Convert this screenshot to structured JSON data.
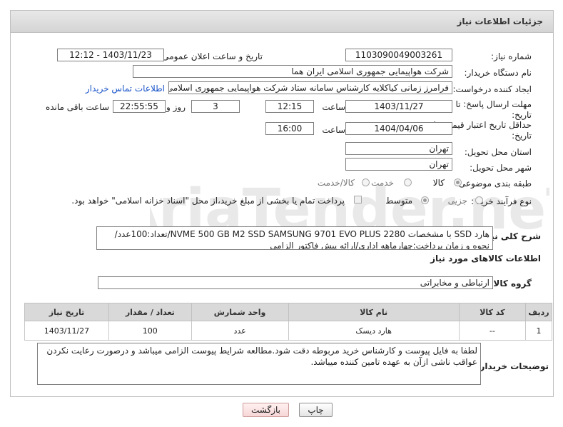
{
  "header": {
    "title": "جزئیات اطلاعات نیاز"
  },
  "fields": {
    "need_number_label": "شماره نیاز:",
    "need_number": "1103090049003261",
    "announce_label": "تاریخ و ساعت اعلان عمومی:",
    "announce_value": "1403/11/23 - 12:12",
    "buyer_org_label": "نام دستگاه خریدار:",
    "buyer_org": "شرکت هواپیمایی جمهوری اسلامی ایران هما",
    "requester_label": "ایجاد کننده درخواست:",
    "requester": "فرامرز زمانی کیاکلایه کارشناس سامانه ستاد شرکت هواپیمایی جمهوری اسلامی",
    "contact_link": "اطلاعات تماس خریدار",
    "reply_deadline_label_1": "مهلت ارسال پاسخ: تا",
    "reply_deadline_label_2": "تاریخ:",
    "reply_date": "1403/11/27",
    "time_label": "ساعت",
    "reply_time": "12:15",
    "days_value": "3",
    "days_label": "روز و",
    "remaining_time": "22:55:55",
    "remaining_label": "ساعت باقی مانده",
    "price_validity_label_1": "حداقل تاریخ اعتبار قیمت: تا",
    "price_validity_label_2": "تاریخ:",
    "price_date": "1404/04/06",
    "price_time": "16:00",
    "province_label": "استان محل تحویل:",
    "province": "تهران",
    "city_label": "شهر محل تحویل:",
    "city": "تهران",
    "category_label": "طبقه بندی موضوعی:",
    "category_options": [
      "کالا",
      "خدمت",
      "کالا/خدمت"
    ],
    "process_label": "نوع فرآیند خرید :",
    "process_options": [
      "جزیی",
      "متوسط"
    ],
    "payment_note": "پرداخت تمام یا بخشی از مبلغ خرید،از محل \"اسناد خزانه اسلامی\" خواهد بود."
  },
  "description": {
    "label": "شرح کلی نیاز:",
    "text": "هارد SSD با مشخصات NVME 500 GB M2 SSD  SAMSUNG 9701 EVO PLUS 2280/تعداد:100عدد/نحوه و زمان پرداخت:چهارماهه اداری/ارائه پیش فاکتور الزامی"
  },
  "goods_info": {
    "title": "اطلاعات کالاهای مورد نیاز",
    "group_label": "گروه کالا:",
    "group_value": "ارتباطی و مخابراتی"
  },
  "table": {
    "headers": [
      "ردیف",
      "کد کالا",
      "نام کالا",
      "واحد شمارش",
      "تعداد / مقدار",
      "تاریخ نیاز"
    ],
    "rows": [
      [
        "1",
        "--",
        "هارد دیسک",
        "عدد",
        "100",
        "1403/11/27"
      ]
    ]
  },
  "buyer_notes": {
    "label": "توضیحات خریدار:",
    "text": "لطفا به فایل پیوست و کارشناس خرید مربوطه دقت شود.مطالعه شرایط پیوست الزامی میباشد و درصورت رعایت نکردن عواقب ناشی ازآن به عهده تامین کننده میباشد."
  },
  "buttons": {
    "print": "چاپ",
    "back": "بازگشت"
  },
  "watermark": {
    "text": "AriaTender.neT"
  },
  "colors": {
    "link": "#1a55c8",
    "header_bg": "#d9d9d9",
    "back_button": "#f7d7d7"
  }
}
